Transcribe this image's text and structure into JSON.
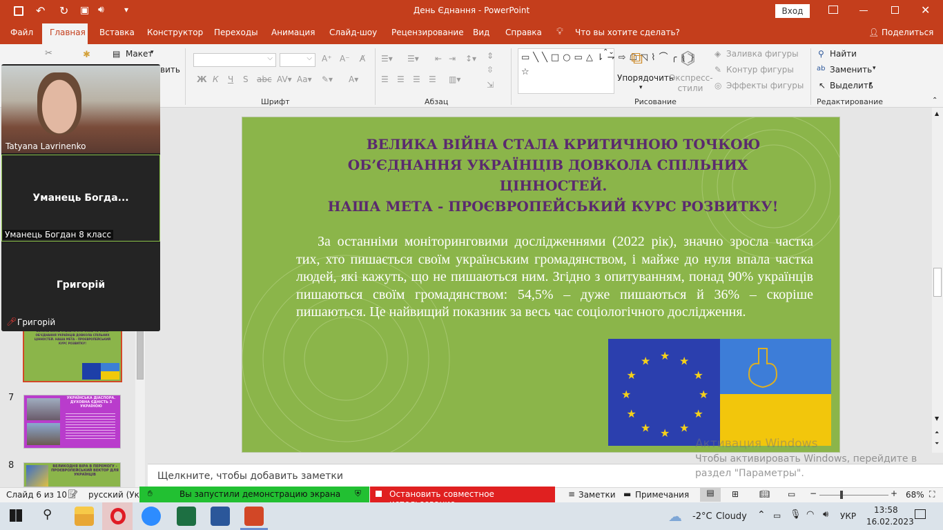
{
  "window": {
    "title": "День Єднання  -  PowerPoint",
    "signin_label": "Вход"
  },
  "tabs": [
    "Файл",
    "Главная",
    "Вставка",
    "Конструктор",
    "Переходы",
    "Анимация",
    "Слайд-шоу",
    "Рецензирование",
    "Вид",
    "Справка"
  ],
  "active_tab": "Главная",
  "tellme": "Что вы хотите сделать?",
  "share": "Поделиться",
  "ribbon": {
    "layout": "Макет",
    "restore_partial": "вить",
    "font_label": "Шрифт",
    "paragraph_label": "Абзац",
    "drawing_label": "Рисование",
    "editing_label": "Редактирование",
    "arrange": "Упорядочить",
    "quick_styles": "Экспресс-стили",
    "shape_fill": "Заливка фигуры",
    "shape_outline": "Контур фигуры",
    "shape_effects": "Эффекты фигуры",
    "find": "Найти",
    "replace": "Заменить",
    "select": "Выделить"
  },
  "slide": {
    "heading_lines": [
      "ВЕЛИКА ВІЙНА СТАЛА КРИТИЧНОЮ ТОЧКОЮ",
      "ОБ’ЄДНАННЯ УКРАЇНЦІВ ДОВКОЛА СПІЛЬНИХ",
      "ЦІННОСТЕЙ."
    ],
    "goal_line": "НАША МЕТА - ПРОЄВРОПЕЙСЬКИЙ КУРС РОЗВИТКУ!",
    "body": "За останніми моніторинговими дослідженнями (2022 рік), значно зросла частка тих, хто пишається своїм українським громадянством, і майже до нуля впала частка людей, які кажуть, що не пишаються ним. Згідно з опитуванням, понад 90% українців пишаються своїм громадянством: 54,5% – дуже пишаються й 36% – скоріше пишаються. Це найвищий показник за весь час соціологічного дослідження."
  },
  "thumbnails": [
    {
      "number": "7",
      "title": "УКРАЇНСЬКА ДІАСПОРА. ДУХОВНА ЄДНІСТЬ З УКРАЇНОЮ"
    },
    {
      "number": "8",
      "title": "ВЕЛИКОДНЯ ВІРА В ПЕРЕМОГУ - ПРОЄВРОПЕЙСЬКИЙ ВЕКТОР ДЛЯ УКРАЇНЦІВ"
    }
  ],
  "thumb6_title": "ВЕЛИКА ВІЙНА СТАЛА КРИТИЧНОЮ ТОЧКОЮ ОБ'ЄДНАННЯ УКРАЇНЦІВ ДОВКОЛА СПІЛЬНИХ ЦІННОСТЕЙ. НАША МЕТА - ПРОЄВРОПЕЙСЬКИЙ КУРС РОЗВИТКУ!",
  "notes_placeholder": "Щелкните, чтобы добавить заметки",
  "video": {
    "participant1": "Tatyana Lavrinenko",
    "participant2_short": "Уманець  Богда...",
    "participant2_full": "Уманець Богдан 8 класс",
    "participant3": "Григорій",
    "participant3_label": "Григорій"
  },
  "share_bar": {
    "sharing": "Вы запустили демонстрацию экрана",
    "stop": "Остановить совместное использование"
  },
  "status": {
    "slide": "Слайд 6 из 10",
    "lang": "русский (Укра",
    "notes": "Заметки",
    "comments": "Примечания",
    "zoom": "68%"
  },
  "watermark": {
    "line1": "Активация Windows",
    "line2": "Чтобы активировать Windows, перейдите в",
    "line3": "раздел \"Параметры\"."
  },
  "taskbar": {
    "weather_temp": "-2°C",
    "weather_desc": "Cloudy",
    "lang": "УКР",
    "time": "13:58",
    "date": "16.02.2023"
  },
  "colors": {
    "accent": "#c43e1c",
    "slide_bg": "#8bb54a",
    "heading": "#5a2a6e",
    "share_green": "#22c032",
    "share_red": "#e02020"
  }
}
